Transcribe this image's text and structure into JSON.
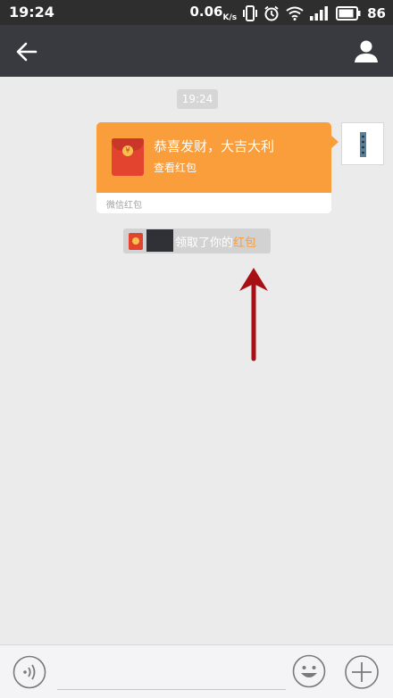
{
  "status_bar": {
    "time": "19:24",
    "net_speed": "0.06",
    "net_unit": "K/s",
    "battery": "86",
    "icons": [
      "vibrate-icon",
      "alarm-icon",
      "wifi-icon",
      "signal-icon",
      "battery-icon"
    ]
  },
  "nav": {
    "back_icon": "back-arrow-icon",
    "profile_icon": "profile-icon"
  },
  "chat": {
    "timestamp": "19:24",
    "red_packet": {
      "title": "恭喜发财，大吉大利",
      "action": "查看红包",
      "footer": "微信红包",
      "coin_symbol": "¥"
    },
    "notice": {
      "text": "领取了你的",
      "link": "红包"
    }
  },
  "input_bar": {
    "icons": [
      "voice-icon",
      "emoji-icon",
      "plus-icon"
    ]
  },
  "colors": {
    "nav_bg": "#393a3f",
    "status_bg": "#2e2e2e",
    "chat_bg": "#ebebeb",
    "red_packet": "#fa9d3b",
    "annotation_arrow": "#a80f14"
  }
}
